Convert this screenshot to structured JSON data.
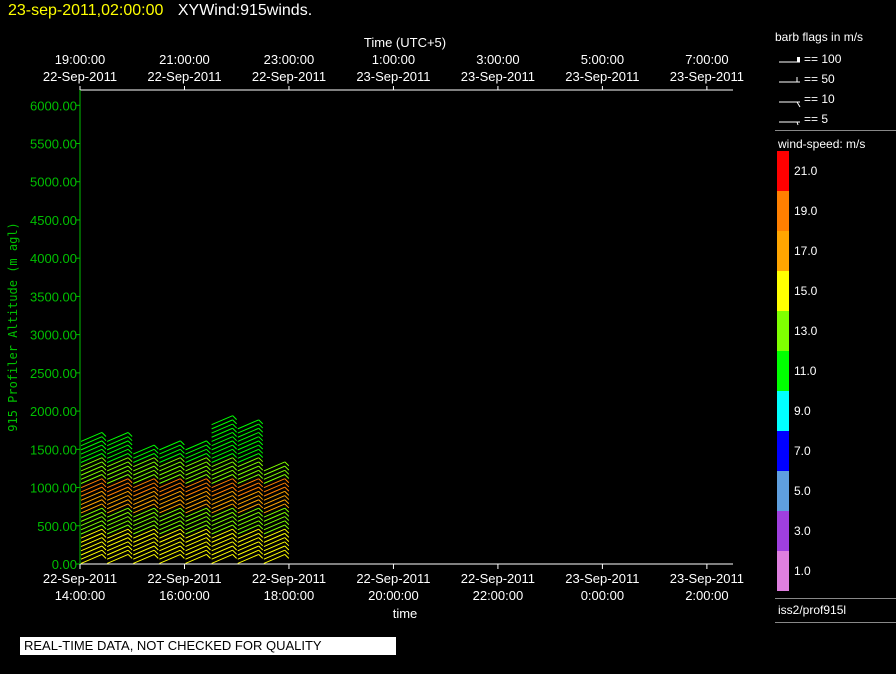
{
  "header": {
    "timestamp": "23-sep-2011,02:00:00",
    "product": "XYWind:915winds."
  },
  "chart_data": {
    "type": "wind-barb time-height",
    "title": "XYWind:915winds.",
    "top_axis_label": "Time (UTC+5)",
    "bottom_axis_label": "time",
    "ylabel": "915 Profiler Altitude (m agl)",
    "ylim": [
      0,
      6200
    ],
    "y_ticks": [
      "0.00",
      "500.00",
      "1000.00",
      "1500.00",
      "2000.00",
      "2500.00",
      "3000.00",
      "3500.00",
      "4000.00",
      "4500.00",
      "5000.00",
      "5500.00",
      "6000.00"
    ],
    "bottom_ticks": [
      {
        "date": "22-Sep-2011",
        "time": "14:00:00"
      },
      {
        "date": "22-Sep-2011",
        "time": "16:00:00"
      },
      {
        "date": "22-Sep-2011",
        "time": "18:00:00"
      },
      {
        "date": "22-Sep-2011",
        "time": "20:00:00"
      },
      {
        "date": "22-Sep-2011",
        "time": "22:00:00"
      },
      {
        "date": "23-Sep-2011",
        "time": "0:00:00"
      },
      {
        "date": "23-Sep-2011",
        "time": "2:00:00"
      }
    ],
    "top_ticks": [
      {
        "time": "19:00:00",
        "date": "22-Sep-2011"
      },
      {
        "time": "21:00:00",
        "date": "22-Sep-2011"
      },
      {
        "time": "23:00:00",
        "date": "22-Sep-2011"
      },
      {
        "time": "1:00:00",
        "date": "23-Sep-2011"
      },
      {
        "time": "3:00:00",
        "date": "23-Sep-2011"
      },
      {
        "time": "5:00:00",
        "date": "23-Sep-2011"
      },
      {
        "time": "7:00:00",
        "date": "23-Sep-2011"
      }
    ],
    "x_hours_range": [
      14,
      26.5
    ],
    "profile_hours": [
      14.0,
      14.5,
      15.0,
      15.5,
      16.0,
      16.5,
      17.0,
      17.5
    ],
    "profile_tops": [
      1700,
      1700,
      1500,
      1550,
      1550,
      1900,
      1850,
      1300
    ],
    "grid": false
  },
  "legend": {
    "barb_header": "barb flags in m/s",
    "barbs": [
      "== 100",
      "== 50",
      "== 10",
      "== 5"
    ],
    "speed_header": "wind-speed: m/s",
    "colorbar": [
      {
        "label": "21.0",
        "color": "#ff0000"
      },
      {
        "label": "19.0",
        "color": "#ff7f00"
      },
      {
        "label": "17.0",
        "color": "#ffa500"
      },
      {
        "label": "15.0",
        "color": "#ffff00"
      },
      {
        "label": "13.0",
        "color": "#7fff00"
      },
      {
        "label": "11.0",
        "color": "#00ff00"
      },
      {
        "label": "9.0",
        "color": "#00ffff"
      },
      {
        "label": "7.0",
        "color": "#0000ff"
      },
      {
        "label": "5.0",
        "color": "#5f9fdf"
      },
      {
        "label": "3.0",
        "color": "#9f3fdf"
      },
      {
        "label": "1.0",
        "color": "#df7fdf"
      }
    ],
    "station": "iss2/prof915l"
  },
  "footer": {
    "quality_notice": "REAL-TIME DATA, NOT CHECKED FOR QUALITY"
  },
  "colors": {
    "axis_green": "#00c000",
    "axis_white": "#ffffff",
    "title_yellow": "#ffff00"
  }
}
